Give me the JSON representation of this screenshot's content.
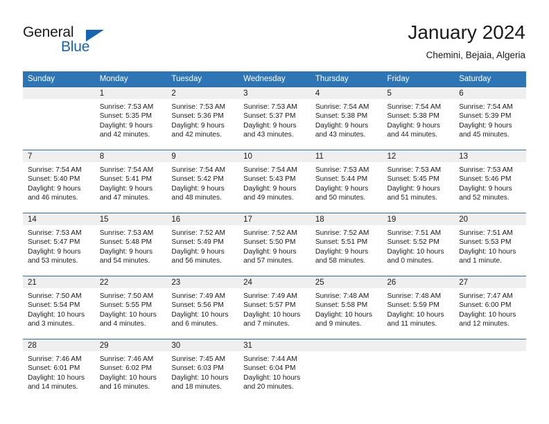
{
  "brand": {
    "name_part1": "General",
    "name_part2": "Blue",
    "triangle_color": "#1565b0"
  },
  "header": {
    "month_title": "January 2024",
    "location": "Chemini, Bejaia, Algeria"
  },
  "theme": {
    "header_row_bg": "#2e75b6",
    "day_number_bg": "#efefef",
    "row_divider": "#2e6da4",
    "text": "#1a1a1a"
  },
  "calendar": {
    "weekday_headers": [
      "Sunday",
      "Monday",
      "Tuesday",
      "Wednesday",
      "Thursday",
      "Friday",
      "Saturday"
    ],
    "weeks": [
      [
        {
          "day": "",
          "sunrise": "",
          "sunset": "",
          "daylight": "",
          "empty": true
        },
        {
          "day": "1",
          "sunrise": "Sunrise: 7:53 AM",
          "sunset": "Sunset: 5:35 PM",
          "daylight": "Daylight: 9 hours and 42 minutes."
        },
        {
          "day": "2",
          "sunrise": "Sunrise: 7:53 AM",
          "sunset": "Sunset: 5:36 PM",
          "daylight": "Daylight: 9 hours and 42 minutes."
        },
        {
          "day": "3",
          "sunrise": "Sunrise: 7:53 AM",
          "sunset": "Sunset: 5:37 PM",
          "daylight": "Daylight: 9 hours and 43 minutes."
        },
        {
          "day": "4",
          "sunrise": "Sunrise: 7:54 AM",
          "sunset": "Sunset: 5:38 PM",
          "daylight": "Daylight: 9 hours and 43 minutes."
        },
        {
          "day": "5",
          "sunrise": "Sunrise: 7:54 AM",
          "sunset": "Sunset: 5:38 PM",
          "daylight": "Daylight: 9 hours and 44 minutes."
        },
        {
          "day": "6",
          "sunrise": "Sunrise: 7:54 AM",
          "sunset": "Sunset: 5:39 PM",
          "daylight": "Daylight: 9 hours and 45 minutes."
        }
      ],
      [
        {
          "day": "7",
          "sunrise": "Sunrise: 7:54 AM",
          "sunset": "Sunset: 5:40 PM",
          "daylight": "Daylight: 9 hours and 46 minutes."
        },
        {
          "day": "8",
          "sunrise": "Sunrise: 7:54 AM",
          "sunset": "Sunset: 5:41 PM",
          "daylight": "Daylight: 9 hours and 47 minutes."
        },
        {
          "day": "9",
          "sunrise": "Sunrise: 7:54 AM",
          "sunset": "Sunset: 5:42 PM",
          "daylight": "Daylight: 9 hours and 48 minutes."
        },
        {
          "day": "10",
          "sunrise": "Sunrise: 7:54 AM",
          "sunset": "Sunset: 5:43 PM",
          "daylight": "Daylight: 9 hours and 49 minutes."
        },
        {
          "day": "11",
          "sunrise": "Sunrise: 7:53 AM",
          "sunset": "Sunset: 5:44 PM",
          "daylight": "Daylight: 9 hours and 50 minutes."
        },
        {
          "day": "12",
          "sunrise": "Sunrise: 7:53 AM",
          "sunset": "Sunset: 5:45 PM",
          "daylight": "Daylight: 9 hours and 51 minutes."
        },
        {
          "day": "13",
          "sunrise": "Sunrise: 7:53 AM",
          "sunset": "Sunset: 5:46 PM",
          "daylight": "Daylight: 9 hours and 52 minutes."
        }
      ],
      [
        {
          "day": "14",
          "sunrise": "Sunrise: 7:53 AM",
          "sunset": "Sunset: 5:47 PM",
          "daylight": "Daylight: 9 hours and 53 minutes."
        },
        {
          "day": "15",
          "sunrise": "Sunrise: 7:53 AM",
          "sunset": "Sunset: 5:48 PM",
          "daylight": "Daylight: 9 hours and 54 minutes."
        },
        {
          "day": "16",
          "sunrise": "Sunrise: 7:52 AM",
          "sunset": "Sunset: 5:49 PM",
          "daylight": "Daylight: 9 hours and 56 minutes."
        },
        {
          "day": "17",
          "sunrise": "Sunrise: 7:52 AM",
          "sunset": "Sunset: 5:50 PM",
          "daylight": "Daylight: 9 hours and 57 minutes."
        },
        {
          "day": "18",
          "sunrise": "Sunrise: 7:52 AM",
          "sunset": "Sunset: 5:51 PM",
          "daylight": "Daylight: 9 hours and 58 minutes."
        },
        {
          "day": "19",
          "sunrise": "Sunrise: 7:51 AM",
          "sunset": "Sunset: 5:52 PM",
          "daylight": "Daylight: 10 hours and 0 minutes."
        },
        {
          "day": "20",
          "sunrise": "Sunrise: 7:51 AM",
          "sunset": "Sunset: 5:53 PM",
          "daylight": "Daylight: 10 hours and 1 minute."
        }
      ],
      [
        {
          "day": "21",
          "sunrise": "Sunrise: 7:50 AM",
          "sunset": "Sunset: 5:54 PM",
          "daylight": "Daylight: 10 hours and 3 minutes."
        },
        {
          "day": "22",
          "sunrise": "Sunrise: 7:50 AM",
          "sunset": "Sunset: 5:55 PM",
          "daylight": "Daylight: 10 hours and 4 minutes."
        },
        {
          "day": "23",
          "sunrise": "Sunrise: 7:49 AM",
          "sunset": "Sunset: 5:56 PM",
          "daylight": "Daylight: 10 hours and 6 minutes."
        },
        {
          "day": "24",
          "sunrise": "Sunrise: 7:49 AM",
          "sunset": "Sunset: 5:57 PM",
          "daylight": "Daylight: 10 hours and 7 minutes."
        },
        {
          "day": "25",
          "sunrise": "Sunrise: 7:48 AM",
          "sunset": "Sunset: 5:58 PM",
          "daylight": "Daylight: 10 hours and 9 minutes."
        },
        {
          "day": "26",
          "sunrise": "Sunrise: 7:48 AM",
          "sunset": "Sunset: 5:59 PM",
          "daylight": "Daylight: 10 hours and 11 minutes."
        },
        {
          "day": "27",
          "sunrise": "Sunrise: 7:47 AM",
          "sunset": "Sunset: 6:00 PM",
          "daylight": "Daylight: 10 hours and 12 minutes."
        }
      ],
      [
        {
          "day": "28",
          "sunrise": "Sunrise: 7:46 AM",
          "sunset": "Sunset: 6:01 PM",
          "daylight": "Daylight: 10 hours and 14 minutes."
        },
        {
          "day": "29",
          "sunrise": "Sunrise: 7:46 AM",
          "sunset": "Sunset: 6:02 PM",
          "daylight": "Daylight: 10 hours and 16 minutes."
        },
        {
          "day": "30",
          "sunrise": "Sunrise: 7:45 AM",
          "sunset": "Sunset: 6:03 PM",
          "daylight": "Daylight: 10 hours and 18 minutes."
        },
        {
          "day": "31",
          "sunrise": "Sunrise: 7:44 AM",
          "sunset": "Sunset: 6:04 PM",
          "daylight": "Daylight: 10 hours and 20 minutes."
        },
        {
          "day": "",
          "sunrise": "",
          "sunset": "",
          "daylight": "",
          "empty": true
        },
        {
          "day": "",
          "sunrise": "",
          "sunset": "",
          "daylight": "",
          "empty": true
        },
        {
          "day": "",
          "sunrise": "",
          "sunset": "",
          "daylight": "",
          "empty": true
        }
      ]
    ]
  }
}
